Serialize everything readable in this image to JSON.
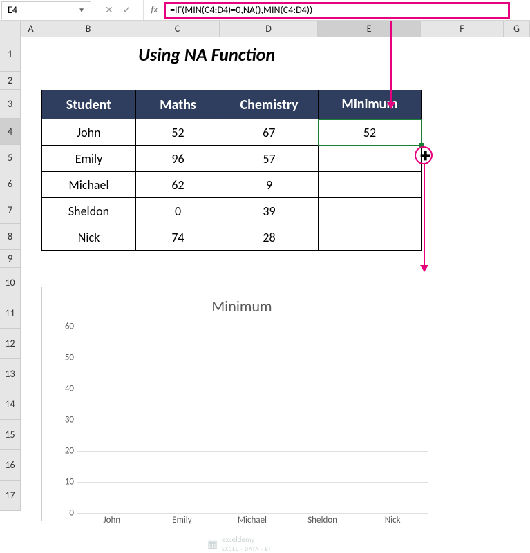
{
  "name_box": "E4",
  "formula": "=IF(MIN(C4:D4)=0,NA(),MIN(C4:D4))",
  "title": "Using NA Function",
  "columns": [
    "A",
    "B",
    "C",
    "D",
    "E",
    "F",
    "G"
  ],
  "rows": [
    "1",
    "2",
    "3",
    "4",
    "5",
    "6",
    "7",
    "8",
    "9",
    "10",
    "11",
    "12",
    "13",
    "14",
    "15",
    "16",
    "17"
  ],
  "table": {
    "headers": {
      "student": "Student",
      "maths": "Maths",
      "chem": "Chemistry",
      "min": "Minimum"
    },
    "rows": [
      {
        "student": "John",
        "maths": "52",
        "chem": "67",
        "min": "52"
      },
      {
        "student": "Emily",
        "maths": "96",
        "chem": "57",
        "min": ""
      },
      {
        "student": "Michael",
        "maths": "62",
        "chem": "9",
        "min": ""
      },
      {
        "student": "Sheldon",
        "maths": "0",
        "chem": "39",
        "min": ""
      },
      {
        "student": "Nick",
        "maths": "74",
        "chem": "28",
        "min": ""
      }
    ]
  },
  "chart_data": {
    "type": "bar",
    "title": "Minimum",
    "categories": [
      "John",
      "Emily",
      "Michael",
      "Sheldon",
      "Nick"
    ],
    "values": [
      null,
      null,
      null,
      null,
      null
    ],
    "y_ticks": [
      0,
      10,
      20,
      30,
      40,
      50,
      60
    ],
    "ylim": [
      0,
      60
    ],
    "xlabel": "",
    "ylabel": ""
  },
  "watermark": {
    "brand": "exceldemy",
    "tag": "EXCEL · DATA · BI"
  }
}
